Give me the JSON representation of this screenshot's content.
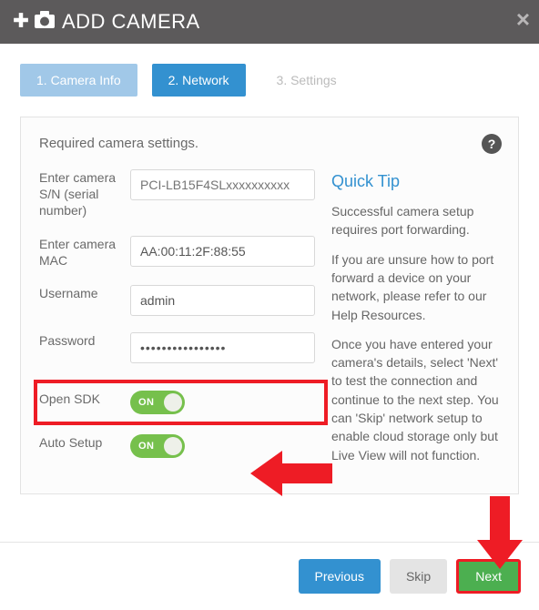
{
  "header": {
    "title": "ADD CAMERA"
  },
  "tabs": {
    "t1": "1. Camera Info",
    "t2": "2. Network",
    "t3": "3. Settings"
  },
  "panel": {
    "title": "Required camera settings."
  },
  "form": {
    "sn_label": "Enter camera S/N (serial number)",
    "sn_placeholder": "PCI-LB15F4SLxxxxxxxxxx",
    "mac_label": "Enter camera MAC",
    "mac_value": "AA:00:11:2F:88:55",
    "user_label": "Username",
    "user_value": "admin",
    "pwd_label": "Password",
    "pwd_value": "••••••••••••••••",
    "sdk_label": "Open SDK",
    "sdk_state": "ON",
    "auto_label": "Auto Setup",
    "auto_state": "ON"
  },
  "tip": {
    "title": "Quick Tip",
    "p1": "Successful camera setup requires port forwarding.",
    "p2": "If you are unsure how to port forward a device on your network, please refer to our Help Resources.",
    "p3": "Once you have entered your camera's details, select 'Next' to test the connection and continue to the next step. You can 'Skip' network setup to enable cloud storage only but Live View will not function."
  },
  "footer": {
    "prev": "Previous",
    "skip": "Skip",
    "next": "Next"
  }
}
